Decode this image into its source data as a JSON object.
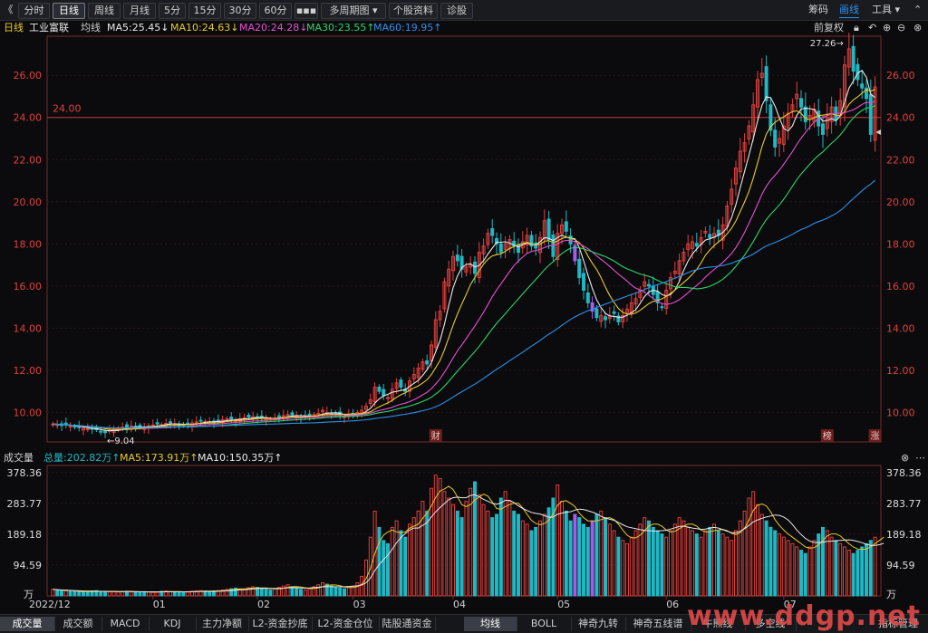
{
  "toolbar": {
    "back": "《",
    "periods": [
      "分时",
      "日线",
      "周线",
      "月线",
      "5分",
      "15分",
      "30分",
      "60分",
      "▪▪▪",
      "多周期图 ▾",
      "个股资料",
      "诊股"
    ],
    "active_index": 1,
    "right": [
      "筹码",
      "画线",
      "工具 ▾"
    ],
    "right_active": 1
  },
  "ma_line": {
    "period": "日线",
    "stock": "工业富联",
    "label": "均线",
    "ma5": "MA5:25.45↓",
    "ma10": "MA10:24.63↓",
    "ma20": "MA20:24.28↓",
    "ma30": "MA30:23.55↑",
    "ma60": "MA60:19.95↑",
    "adjust": "前复权"
  },
  "colors": {
    "ma5": "#e8e8e8",
    "ma10": "#e8c92a",
    "ma20": "#e44fd0",
    "ma30": "#2bd36a",
    "ma60": "#2f8fe8",
    "up": "#e0403c",
    "down": "#1fb8c4",
    "axis_text": "#e0403c"
  },
  "price_axis": {
    "ticks": [
      "26.00",
      "24.00",
      "22.00",
      "20.00",
      "18.00",
      "16.00",
      "14.00",
      "12.00",
      "10.00"
    ],
    "ref_line_label": "24.00",
    "high_label": "27.26→",
    "low_label": "←9.04"
  },
  "event_markers": [
    "财",
    "榜",
    "涨"
  ],
  "vol_head": {
    "title": "成交量",
    "total": "总量:202.82万↑",
    "ma5": "MA5:173.91万↑",
    "ma10": "MA10:150.35万↑"
  },
  "vol_axis": {
    "ticks": [
      "378.36",
      "283.77",
      "189.18",
      "94.59"
    ],
    "unit": "万"
  },
  "date_axis": [
    "2022/12",
    "01",
    "02",
    "03",
    "04",
    "05",
    "06",
    "07"
  ],
  "bottom_tabs": [
    "成交量",
    "成交额",
    "MACD",
    "KDJ",
    "主力净额",
    "L2-资金抄底",
    "L2-资金仓位",
    "陆股通资金"
  ],
  "bottom_tabs_right": [
    "均线",
    "BOLL",
    "神奇九转",
    "神奇五线谱",
    "牛熊线",
    "多空线"
  ],
  "bottom_active": 0,
  "bottom_right_active": 0,
  "bottom_end": "指标管理",
  "watermark": "www.ddgp.net",
  "chart_data": {
    "type": "candlestick",
    "price_ylim": [
      8.6,
      27.6
    ],
    "volume_ylim": [
      0,
      400
    ],
    "x": [
      "2022/12",
      "01",
      "02",
      "03",
      "04",
      "05",
      "06",
      "07"
    ],
    "close": [
      9.45,
      9.42,
      9.38,
      9.4,
      9.35,
      9.3,
      9.28,
      9.25,
      9.22,
      9.2,
      9.18,
      9.1,
      9.04,
      9.15,
      9.2,
      9.25,
      9.3,
      9.28,
      9.35,
      9.32,
      9.3,
      9.28,
      9.35,
      9.4,
      9.45,
      9.42,
      9.48,
      9.5,
      9.45,
      9.4,
      9.38,
      9.42,
      9.5,
      9.55,
      9.6,
      9.58,
      9.55,
      9.52,
      9.6,
      9.65,
      9.7,
      9.68,
      9.62,
      9.7,
      9.75,
      9.78,
      9.8,
      9.75,
      9.72,
      9.7,
      9.68,
      9.72,
      9.8,
      9.85,
      9.9,
      9.88,
      9.82,
      9.78,
      9.8,
      9.85,
      9.9,
      9.95,
      10.1,
      10.0,
      9.95,
      9.9,
      9.85,
      9.8,
      9.88,
      9.95,
      10.0,
      10.1,
      10.3,
      10.6,
      11.2,
      11.0,
      10.8,
      10.7,
      11.1,
      11.4,
      11.2,
      11.0,
      11.5,
      11.8,
      12.1,
      12.4,
      12.3,
      13.2,
      14.4,
      14.8,
      16.2,
      16.8,
      17.4,
      17.2,
      16.8,
      16.9,
      17.0,
      16.6,
      17.6,
      17.9,
      18.5,
      18.4,
      18.0,
      17.6,
      18.0,
      18.2,
      17.9,
      17.6,
      18.1,
      18.4,
      17.9,
      17.8,
      18.3,
      19.1,
      18.2,
      17.4,
      18.5,
      18.9,
      18.6,
      18.0,
      17.2,
      16.4,
      15.8,
      15.2,
      14.8,
      14.5,
      14.6,
      14.4,
      14.6,
      14.7,
      14.3,
      14.6,
      14.9,
      15.2,
      15.4,
      15.8,
      16.2,
      16.0,
      15.6,
      15.2,
      15.0,
      15.8,
      16.4,
      16.7,
      17.2,
      17.6,
      18.0,
      18.1,
      17.9,
      18.3,
      18.6,
      18.3,
      18.5,
      18.4,
      18.9,
      19.8,
      20.6,
      21.6,
      22.4,
      22.8,
      23.6,
      24.6,
      25.8,
      26.1,
      24.8,
      23.4,
      22.6,
      23.0,
      23.6,
      24.2,
      24.6,
      25.1,
      24.5,
      23.8,
      24.1,
      24.4,
      23.6,
      23.2,
      24.0,
      24.5,
      23.9,
      24.8,
      26.5,
      27.26,
      26.2,
      25.8,
      25.4,
      24.9,
      23.2,
      25.45
    ],
    "volume": [
      20,
      18,
      16,
      15,
      14,
      13,
      12,
      12,
      13,
      15,
      16,
      14,
      12,
      13,
      14,
      12,
      13,
      14,
      12,
      11,
      12,
      13,
      12,
      11,
      12,
      14,
      15,
      13,
      12,
      11,
      12,
      13,
      14,
      15,
      16,
      15,
      14,
      15,
      16,
      18,
      20,
      22,
      24,
      22,
      20,
      25,
      28,
      26,
      22,
      20,
      18,
      22,
      26,
      30,
      34,
      28,
      24,
      20,
      18,
      22,
      28,
      34,
      40,
      36,
      30,
      26,
      24,
      22,
      26,
      30,
      40,
      60,
      110,
      180,
      260,
      210,
      170,
      160,
      210,
      230,
      200,
      180,
      220,
      240,
      260,
      290,
      260,
      330,
      370,
      360,
      320,
      300,
      280,
      260,
      240,
      290,
      330,
      350,
      310,
      280,
      260,
      240,
      250,
      300,
      320,
      290,
      260,
      250,
      230,
      220,
      200,
      210,
      230,
      250,
      270,
      300,
      340,
      290,
      260,
      230,
      250,
      240,
      220,
      210,
      230,
      250,
      260,
      240,
      220,
      200,
      180,
      170,
      160,
      180,
      200,
      220,
      240,
      230,
      210,
      200,
      190,
      180,
      200,
      220,
      240,
      230,
      210,
      200,
      190,
      180,
      200,
      210,
      220,
      200,
      190,
      180,
      170,
      200,
      230,
      260,
      300,
      320,
      280,
      250,
      230,
      210,
      200,
      190,
      180,
      170,
      160,
      150,
      140,
      130,
      150,
      170,
      190,
      210,
      200,
      180,
      170,
      160,
      150,
      140,
      130,
      140,
      150,
      160,
      170,
      180,
      190,
      200
    ]
  }
}
